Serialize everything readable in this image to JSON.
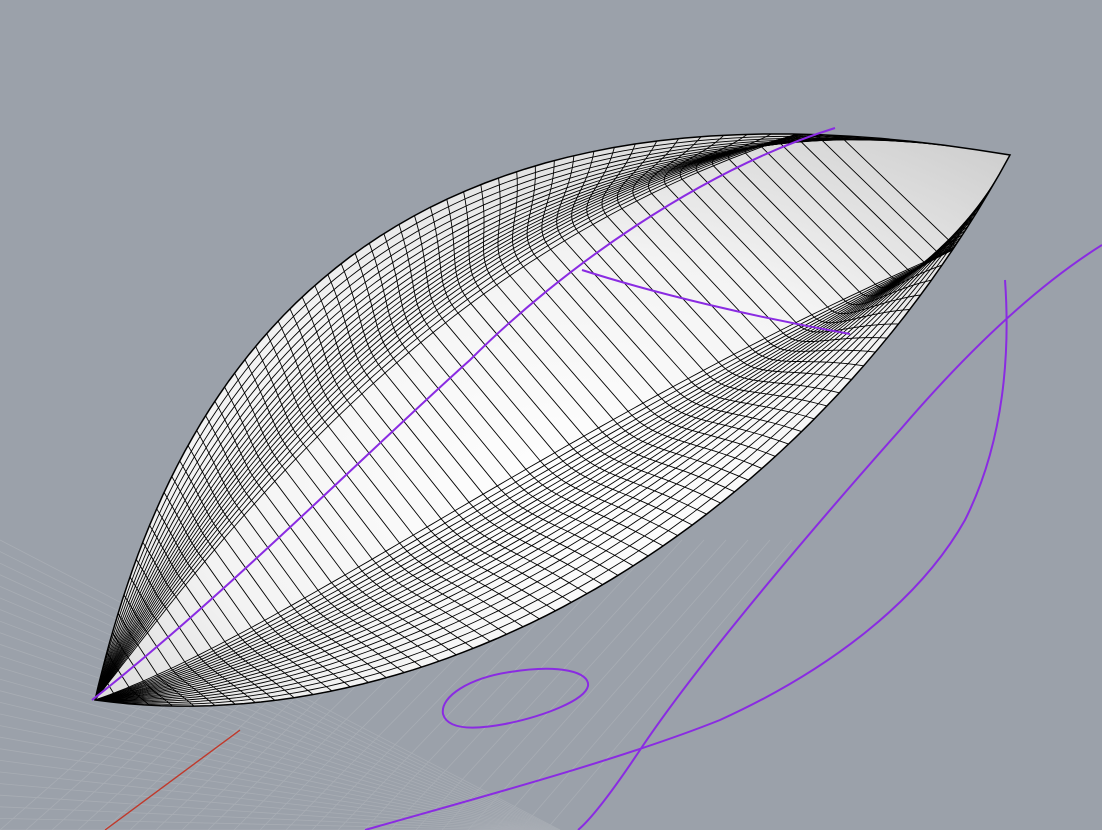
{
  "viewport": {
    "view": "perspective",
    "display_mode": "shaded",
    "background_color": "#9ba1aa",
    "grid_color": "#a8adb4",
    "x_axis_color": "#c0392b",
    "surface": {
      "name": "surface",
      "fill_color": "#ffffff",
      "isocurve_color": "#000000",
      "u_isocurves": 44,
      "v_isocurves": 60
    },
    "curves": {
      "color": "#8a2be2",
      "items": [
        "centerline-curve",
        "closed-loop-curve",
        "figure-eight-curve",
        "cross-section-curve"
      ]
    }
  }
}
